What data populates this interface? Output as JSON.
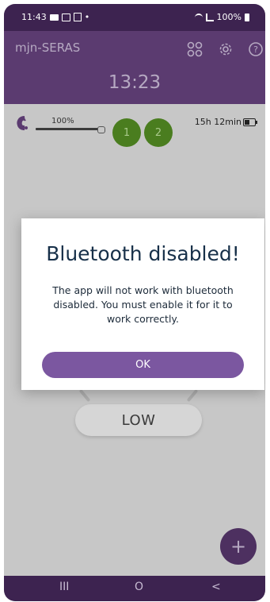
{
  "status_bar": {
    "time": "11:43",
    "dot": "•",
    "battery": "100%",
    "icons": [
      "mail-icon",
      "cast-icon",
      "nfc-icon",
      "wifi-icon",
      "signal-icon",
      "battery-icon"
    ]
  },
  "header": {
    "app_title": "mjn-SERAS",
    "clock": "13:23",
    "icons": [
      "grid-icon",
      "gear-icon",
      "help-icon"
    ]
  },
  "device": {
    "volume_label": "100%",
    "volume_fraction": 1.0,
    "programs": [
      "1",
      "2"
    ],
    "battery_time": "15h 12min"
  },
  "mode_button": {
    "label": "LOW"
  },
  "fab": {
    "label": "+"
  },
  "dialog": {
    "title": "Bluetooth disabled!",
    "message": "The app will not work with bluetooth disabled. You must enable it for it to work correctly.",
    "ok_label": "OK"
  },
  "nav_bar": {
    "recents": "III",
    "home": "O",
    "back": "<"
  },
  "colors": {
    "primary": "#5b3b70",
    "status": "#3d2350",
    "accent": "#7b57a0",
    "program_green": "#4a7d1f"
  }
}
